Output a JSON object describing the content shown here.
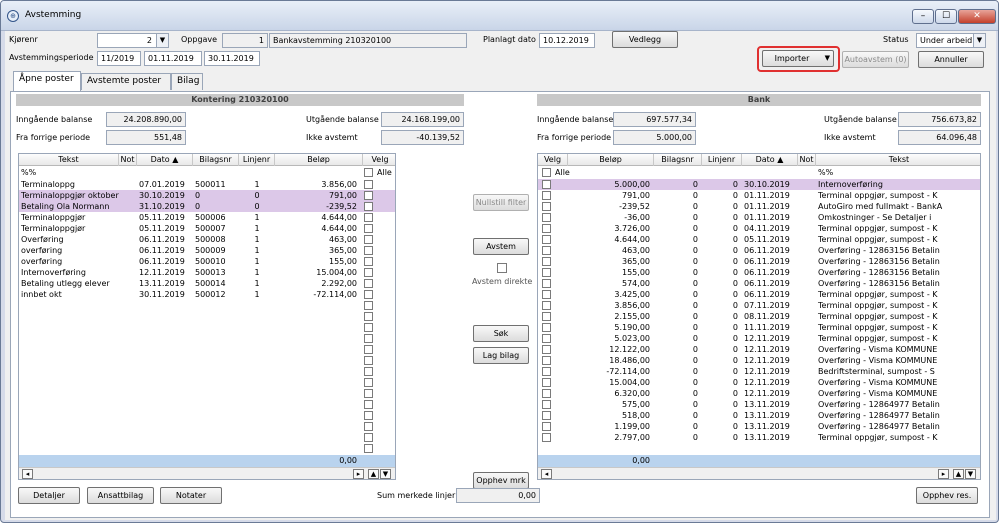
{
  "window": {
    "title": "Avstemming",
    "min": "–",
    "max": "☐",
    "close": "✕"
  },
  "header": {
    "kjorenr_label": "Kjørenr",
    "kjorenr_value": "2",
    "oppgave_label": "Oppgave",
    "oppgave_value": "1",
    "oppgave_name": "Bankavstemming 210320100",
    "planlagt_label": "Planlagt dato",
    "planlagt_value": "10.12.2019",
    "vedlegg": "Vedlegg",
    "status_label": "Status",
    "status_value": "Under arbeid",
    "periode_label": "Avstemmingsperiode",
    "periode": "11/2019",
    "fra": "01.11.2019",
    "til": "30.11.2019",
    "importer": "Importer",
    "autoavstem": "Autoavstem (0)",
    "annuller": "Annuller"
  },
  "tabs": [
    "Åpne poster",
    "Avstemte poster",
    "Bilag"
  ],
  "left": {
    "band": "Kontering 210320100",
    "inng_label": "Inngående balanse",
    "inng_value": "24.208.890,00",
    "forrige_label": "Fra forrige periode",
    "forrige_value": "551,48",
    "utg_label": "Utgående balanse",
    "utg_value": "24.168.199,00",
    "ikke_label": "Ikke avstemt",
    "ikke_value": "-40.139,52",
    "headers": {
      "tekst": "Tekst",
      "not": "Not",
      "dato": "Dato",
      "bilag": "Bilagsnr",
      "linje": "Linjenr",
      "belop": "Beløp",
      "velg": "Velg"
    },
    "filter": "%%",
    "alle": "Alle",
    "rows": [
      [
        "Terminaloppg",
        "07.01.2019",
        "500011",
        "1",
        "3.856,00",
        "n"
      ],
      [
        "Terminaloppgjør oktober",
        "30.10.2019",
        "0",
        "0",
        "791,00",
        "s"
      ],
      [
        "Betaling Ola Normann",
        "31.10.2019",
        "0",
        "0",
        "-239,52",
        "s"
      ],
      [
        "Terminaloppgjør",
        "05.11.2019",
        "500006",
        "1",
        "4.644,00",
        "n"
      ],
      [
        "Terminaloppgjør",
        "05.11.2019",
        "500007",
        "1",
        "4.644,00",
        "n"
      ],
      [
        "Overføring",
        "06.11.2019",
        "500008",
        "1",
        "463,00",
        "n"
      ],
      [
        "overføring",
        "06.11.2019",
        "500009",
        "1",
        "365,00",
        "n"
      ],
      [
        "overføring",
        "06.11.2019",
        "500010",
        "1",
        "155,00",
        "n"
      ],
      [
        "Internoverføring",
        "12.11.2019",
        "500013",
        "1",
        "15.004,00",
        "n"
      ],
      [
        "Betaling utlegg elever",
        "13.11.2019",
        "500014",
        "1",
        "2.292,00",
        "n"
      ],
      [
        "innbet okt",
        "30.11.2019",
        "500012",
        "1",
        "-72.114,00",
        "n"
      ]
    ],
    "total": "0,00"
  },
  "middle": {
    "nullstill": "Nullstill filter",
    "avstem": "Avstem",
    "avstem_direkte": "Avstem direkte",
    "sok": "Søk",
    "lag_bilag": "Lag bilag",
    "opphev_mrk": "Opphev mrk"
  },
  "right": {
    "band": "Bank",
    "inng_label": "Inngående balanse",
    "inng_value": "697.577,34",
    "forrige_label": "Fra forrige periode",
    "forrige_value": "5.000,00",
    "utg_label": "Utgående balanse",
    "utg_value": "756.673,82",
    "ikke_label": "Ikke avstemt",
    "ikke_value": "64.096,48",
    "headers": {
      "velg": "Velg",
      "belop": "Beløp",
      "bilag": "Bilagsnr",
      "linje": "Linjenr",
      "dato": "Dato",
      "not": "Not",
      "tekst": "Tekst"
    },
    "filter": "%%",
    "alle": "Alle",
    "rows": [
      [
        "5.000,00",
        "0",
        "0",
        "30.10.2019",
        "Internoverføring",
        "s"
      ],
      [
        "791,00",
        "0",
        "0",
        "01.11.2019",
        "Terminal oppgjør, sumpost - K",
        "n"
      ],
      [
        "-239,52",
        "0",
        "0",
        "01.11.2019",
        "AutoGiro med fullmakt - BankA",
        "n"
      ],
      [
        "-36,00",
        "0",
        "0",
        "01.11.2019",
        "Omkostninger - Se Detaljer i",
        "n"
      ],
      [
        "3.726,00",
        "0",
        "0",
        "04.11.2019",
        "Terminal oppgjør, sumpost - K",
        "n"
      ],
      [
        "4.644,00",
        "0",
        "0",
        "05.11.2019",
        "Terminal oppgjør, sumpost - K",
        "n"
      ],
      [
        "463,00",
        "0",
        "0",
        "06.11.2019",
        "Overføring - 12863156 Betalin",
        "n"
      ],
      [
        "365,00",
        "0",
        "0",
        "06.11.2019",
        "Overføring - 12863156 Betalin",
        "n"
      ],
      [
        "155,00",
        "0",
        "0",
        "06.11.2019",
        "Overføring - 12863156 Betalin",
        "n"
      ],
      [
        "574,00",
        "0",
        "0",
        "06.11.2019",
        "Overføring - 12863156 Betalin",
        "n"
      ],
      [
        "3.425,00",
        "0",
        "0",
        "06.11.2019",
        "Terminal oppgjør, sumpost - K",
        "n"
      ],
      [
        "3.856,00",
        "0",
        "0",
        "07.11.2019",
        "Terminal oppgjør, sumpost - K",
        "n"
      ],
      [
        "2.155,00",
        "0",
        "0",
        "08.11.2019",
        "Terminal oppgjør, sumpost - K",
        "n"
      ],
      [
        "5.190,00",
        "0",
        "0",
        "11.11.2019",
        "Terminal oppgjør, sumpost - K",
        "n"
      ],
      [
        "5.023,00",
        "0",
        "0",
        "12.11.2019",
        "Terminal oppgjør, sumpost - K",
        "n"
      ],
      [
        "12.122,00",
        "0",
        "0",
        "12.11.2019",
        "Overføring - Visma KOMMUNE",
        "n"
      ],
      [
        "18.486,00",
        "0",
        "0",
        "12.11.2019",
        "Overføring - Visma KOMMUNE",
        "n"
      ],
      [
        "-72.114,00",
        "0",
        "0",
        "12.11.2019",
        "Bedriftsterminal, sumpost - S",
        "n"
      ],
      [
        "15.004,00",
        "0",
        "0",
        "12.11.2019",
        "Overføring - Visma KOMMUNE",
        "n"
      ],
      [
        "6.320,00",
        "0",
        "0",
        "12.11.2019",
        "Overføring - Visma KOMMUNE",
        "n"
      ],
      [
        "575,00",
        "0",
        "0",
        "13.11.2019",
        "Overføring - 12864977 Betalin",
        "n"
      ],
      [
        "518,00",
        "0",
        "0",
        "13.11.2019",
        "Overføring - 12864977 Betalin",
        "n"
      ],
      [
        "1.199,00",
        "0",
        "0",
        "13.11.2019",
        "Overføring - 12864977 Betalin",
        "n"
      ],
      [
        "2.797,00",
        "0",
        "0",
        "13.11.2019",
        "Terminal oppgjør, sumpost - K",
        "n"
      ]
    ],
    "total": "0,00"
  },
  "footer": {
    "detaljer": "Detaljer",
    "ansattbilag": "Ansattbilag",
    "notater": "Notater",
    "sum_label": "Sum merkede linjer",
    "sum_value": "0,00",
    "opphev_res": "Opphev res."
  },
  "colors": {
    "selected_row": "#dcc8e8",
    "total_bar": "#b9d3ee",
    "highlight": "#e03030"
  }
}
